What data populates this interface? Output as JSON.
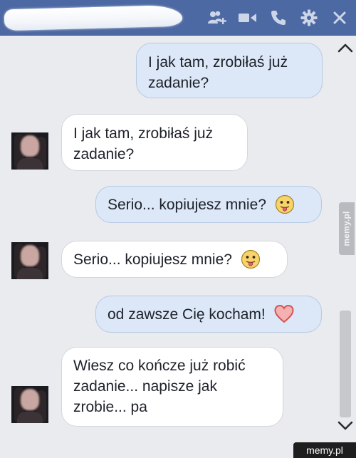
{
  "header": {
    "contact_name": "",
    "icons": [
      "add-friend-icon",
      "video-call-icon",
      "phone-icon",
      "gear-icon",
      "close-icon"
    ],
    "bar_color": "#4d69a3"
  },
  "messages": [
    {
      "side": "out",
      "lines": [
        "I jak tam, zrobiłaś już",
        "zadanie?"
      ],
      "emoji": null
    },
    {
      "side": "in",
      "lines": [
        "I jak tam, zrobiłaś już",
        "zadanie?"
      ],
      "emoji": null
    },
    {
      "side": "out",
      "lines": [
        "Serio... kopiujesz mnie?"
      ],
      "emoji": "tongue-face-emoji"
    },
    {
      "side": "in",
      "lines": [
        "Serio... kopiujesz mnie?"
      ],
      "emoji": "tongue-face-emoji"
    },
    {
      "side": "out",
      "lines": [
        "od zawsze Cię kocham!"
      ],
      "emoji": "heart-emoji"
    },
    {
      "side": "in",
      "lines": [
        "Wiesz co kończe już robić",
        "zadanie... napisze jak",
        "zrobie... pa"
      ],
      "emoji": null
    }
  ],
  "watermarks": {
    "side": "memy.pl",
    "bottom": "memy.pl"
  },
  "colors": {
    "outgoing_bubble": "#dce8f7",
    "incoming_bubble": "#ffffff",
    "background": "#e9ebee"
  }
}
